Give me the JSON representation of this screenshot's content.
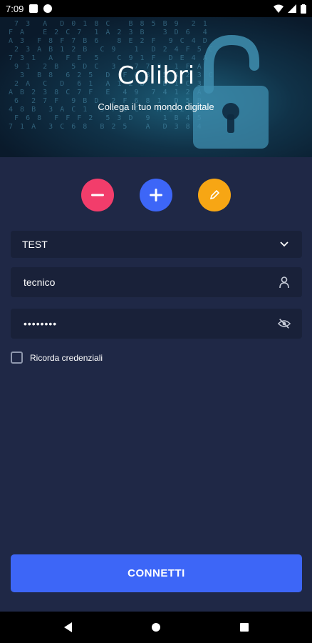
{
  "status_bar": {
    "time": "7:09"
  },
  "hero": {
    "title": "Colibri",
    "subtitle": "Collega il tuo mondo digitale",
    "matrix_text": "  7 3  A  D 0 1 8 C   B 8 5 B 9  2 1\n F A   E 2 C 7  1 A 2 3 B   3 D 6  4\n A 3  F 8 F 7 B 6   8 E 2 F  9 C 4 D\n  2 3 A B 1 2 B  C 9   1  D 2 4 F 5 C\n 7 3 1  A  F E  5   C 9 1 F  D E 4 A\n  9 1  2 B  5 D C  3   7 7 0  1 F A\n   3  B 8  6 2 5  D  F 6 8  5 A 2 3 C\n  2 A  C  D  6 1  A 1 2 B   D 1 C 3\n A B 2 3 8 C 7 F  E  4 9  7 4 1 2 A\n  6  2 7 F  9 B D  2 F 6 8 1  D 5 B\n 4 8 B  3 A C 1  5 7 6 C   A 1 2 B\n  F 6 8  F F F 2  5 3 D  9  1 B 4 5\n 7 1 A  3 C 6 8  B 2 5   A  D 3 8 4"
  },
  "actions": {
    "remove_label": "−",
    "add_label": "+",
    "edit_label": "✎"
  },
  "form": {
    "profile": {
      "value": "TEST"
    },
    "username": {
      "value": "tecnico"
    },
    "password": {
      "value": "••••••••"
    },
    "remember": {
      "label": "Ricorda credenziali",
      "checked": false
    }
  },
  "connect": {
    "label": "CONNETTI"
  },
  "colors": {
    "background": "#1f2846",
    "field": "#192139",
    "remove": "#f23d6b",
    "add": "#3d66f7",
    "edit": "#f7a614",
    "primary": "#3d66f7"
  }
}
